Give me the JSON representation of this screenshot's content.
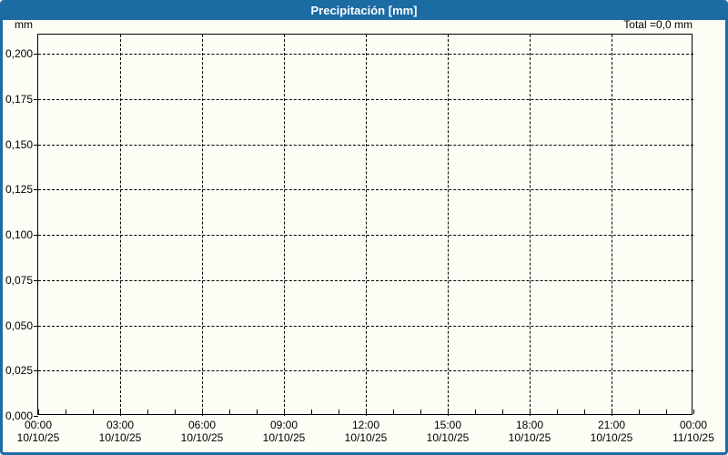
{
  "window": {
    "title": "Precipitación [mm]"
  },
  "summary": {
    "total_label": "Total =0,0 mm"
  },
  "colors": {
    "titlebar": "#1c6ca4",
    "window_border": "#1c6ca4",
    "background": "#fdfdf6",
    "grid": "#000000",
    "text": "#000000",
    "title_text": "#ffffff"
  },
  "chart_data": {
    "type": "bar",
    "title": "Precipitación [mm]",
    "xlabel": "",
    "ylabel": "mm",
    "ylim": [
      0,
      0.21
    ],
    "grid": "dashed",
    "legend": "none",
    "total": "0,0 mm",
    "total_value_mm": 0.0,
    "y_axis": {
      "unit": "mm",
      "ticks": [
        {
          "value": 0.2,
          "label": "0,200"
        },
        {
          "value": 0.175,
          "label": "0,175"
        },
        {
          "value": 0.15,
          "label": "0,150"
        },
        {
          "value": 0.125,
          "label": "0,125"
        },
        {
          "value": 0.1,
          "label": "0,100"
        },
        {
          "value": 0.075,
          "label": "0,075"
        },
        {
          "value": 0.05,
          "label": "0,050"
        },
        {
          "value": 0.025,
          "label": "0,025"
        },
        {
          "value": 0.0,
          "label": "0,000"
        }
      ]
    },
    "x_axis": {
      "start": "10/10/25 00:00",
      "end": "11/10/25 00:00",
      "span_hours": 24,
      "major_tick_hours": 3,
      "minor_tick_hours": 1,
      "ticks": [
        {
          "hour": 0,
          "time": "00:00",
          "date": "10/10/25"
        },
        {
          "hour": 3,
          "time": "03:00",
          "date": "10/10/25"
        },
        {
          "hour": 6,
          "time": "06:00",
          "date": "10/10/25"
        },
        {
          "hour": 9,
          "time": "09:00",
          "date": "10/10/25"
        },
        {
          "hour": 12,
          "time": "12:00",
          "date": "10/10/25"
        },
        {
          "hour": 15,
          "time": "15:00",
          "date": "10/10/25"
        },
        {
          "hour": 18,
          "time": "18:00",
          "date": "10/10/25"
        },
        {
          "hour": 21,
          "time": "21:00",
          "date": "10/10/25"
        },
        {
          "hour": 24,
          "time": "00:00",
          "date": "11/10/25"
        }
      ]
    },
    "series": [
      {
        "name": "Precipitación",
        "values": []
      }
    ]
  }
}
